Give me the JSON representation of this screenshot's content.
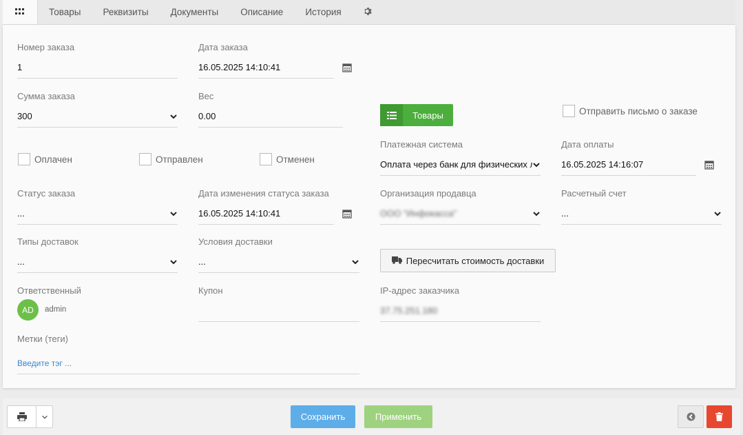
{
  "tabs": {
    "items": [
      "Товары",
      "Реквизиты",
      "Документы",
      "Описание",
      "История"
    ]
  },
  "form": {
    "order_number": {
      "label": "Номер заказа",
      "value": "1"
    },
    "order_date": {
      "label": "Дата заказа",
      "value": "16.05.2025 14:10:41"
    },
    "order_sum": {
      "label": "Сумма заказа",
      "value": "300"
    },
    "weight": {
      "label": "Вес",
      "value": "0.00"
    },
    "goods_button": "Товары",
    "send_email": "Отправить письмо о заказе",
    "paid": "Оплачен",
    "sent": "Отправлен",
    "cancelled": "Отменен",
    "payment_system": {
      "label": "Платежная система",
      "value": "Оплата через банк для физических лиц"
    },
    "payment_date": {
      "label": "Дата оплаты",
      "value": "16.05.2025 14:16:07"
    },
    "order_status": {
      "label": "Статус заказа",
      "value": "..."
    },
    "status_change_date": {
      "label": "Дата изменения статуса заказа",
      "value": "16.05.2025 14:10:41"
    },
    "seller_org": {
      "label": "Организация продавца",
      "value": "ООО \"Инфокасса\""
    },
    "account": {
      "label": "Расчетный счет",
      "value": "..."
    },
    "delivery_types": {
      "label": "Типы доставок",
      "value": "..."
    },
    "delivery_conditions": {
      "label": "Условия доставки",
      "value": "..."
    },
    "recalc_button": "Пересчитать стоимость доставки",
    "responsible": {
      "label": "Ответственный",
      "initials": "AD",
      "name": "admin"
    },
    "coupon": {
      "label": "Купон",
      "value": ""
    },
    "ip": {
      "label": "IP-адрес заказчика",
      "value": "37.75.251.180"
    },
    "tags": {
      "label": "Метки (теги)",
      "placeholder": "Введите тэг ..."
    }
  },
  "footer": {
    "save": "Сохранить",
    "apply": "Применить"
  },
  "colors": {
    "green": "#4cae3c",
    "blue": "#5dade8",
    "red": "#e8472f"
  }
}
